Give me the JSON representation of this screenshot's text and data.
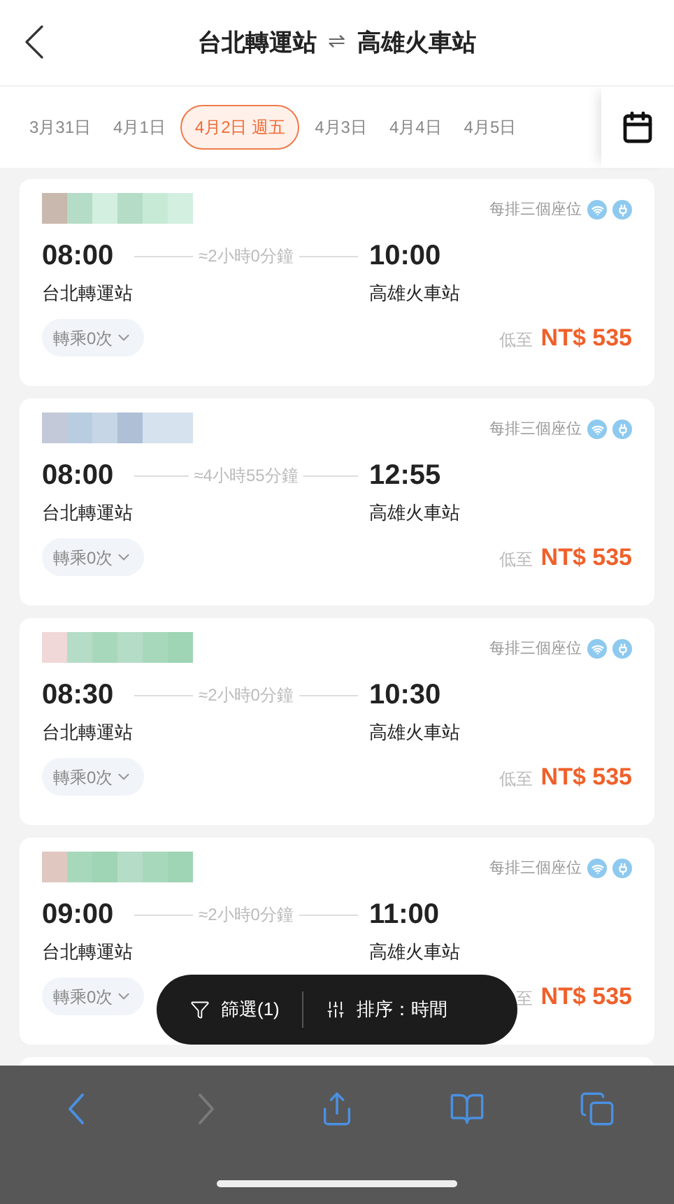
{
  "header": {
    "origin": "台北轉運站",
    "swap": "⇌",
    "destination": "高雄火車站"
  },
  "dates": [
    {
      "label": "3月31日",
      "selected": false
    },
    {
      "label": "4月1日",
      "selected": false
    },
    {
      "label": "4月2日 週五",
      "selected": true
    },
    {
      "label": "4月3日",
      "selected": false
    },
    {
      "label": "4月4日",
      "selected": false
    },
    {
      "label": "4月5日",
      "selected": false
    }
  ],
  "trips": [
    {
      "seats": "每排三個座位",
      "depart": "08:00",
      "duration": "≈2小時0分鐘",
      "arrive": "10:00",
      "from": "台北轉運站",
      "to": "高雄火車站",
      "transfers": "轉乘0次",
      "price_prefix": "低至",
      "price": "NT$ 535"
    },
    {
      "seats": "每排三個座位",
      "depart": "08:00",
      "duration": "≈4小時55分鐘",
      "arrive": "12:55",
      "from": "台北轉運站",
      "to": "高雄火車站",
      "transfers": "轉乘0次",
      "price_prefix": "低至",
      "price": "NT$ 535"
    },
    {
      "seats": "每排三個座位",
      "depart": "08:30",
      "duration": "≈2小時0分鐘",
      "arrive": "10:30",
      "from": "台北轉運站",
      "to": "高雄火車站",
      "transfers": "轉乘0次",
      "price_prefix": "低至",
      "price": "NT$ 535"
    },
    {
      "seats": "每排三個座位",
      "depart": "09:00",
      "duration": "≈2小時0分鐘",
      "arrive": "11:00",
      "from": "台北轉運站",
      "to": "高雄火車站",
      "transfers": "轉乘0次",
      "price_prefix": "至",
      "price": "NT$ 535"
    }
  ],
  "floating_bar": {
    "filter": "篩選(1)",
    "sort": "排序：時間"
  },
  "browser_toolbar": [
    {
      "kind": "back",
      "disabled": false
    },
    {
      "kind": "forward",
      "disabled": true
    },
    {
      "kind": "share",
      "disabled": false
    },
    {
      "kind": "bookmarks",
      "disabled": false
    },
    {
      "kind": "tabs",
      "disabled": false
    }
  ]
}
